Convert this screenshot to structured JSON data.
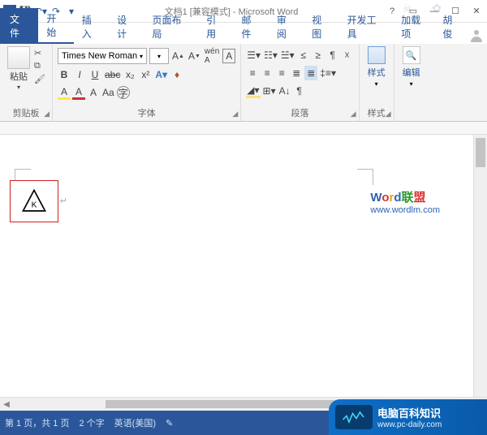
{
  "titlebar": {
    "doc_title": "文档1 [兼容模式] - Microsoft Word"
  },
  "tabs": {
    "file": "文件",
    "home": "开始",
    "insert": "插入",
    "design": "设计",
    "layout": "页面布局",
    "references": "引用",
    "mailings": "邮件",
    "review": "审阅",
    "view": "视图",
    "developer": "开发工具",
    "addins": "加载项",
    "user": "胡俊"
  },
  "ribbon": {
    "clipboard": {
      "label": "剪贴板",
      "paste": "粘贴"
    },
    "font": {
      "label": "字体",
      "name": "Times New Roman",
      "bold": "B",
      "italic": "I",
      "underline": "U",
      "strike": "abc",
      "sub": "x₂",
      "sup": "x²",
      "row3": {
        "a1": "A",
        "a2": "ab/",
        "a3": "A",
        "a4": "Aa",
        "change": "A"
      }
    },
    "paragraph": {
      "label": "段落"
    },
    "styles": {
      "label": "样式",
      "button": "样式"
    },
    "editing": {
      "label": "",
      "button": "编辑"
    }
  },
  "document": {
    "triangle_letter": "K"
  },
  "watermark": {
    "text": "Word联盟",
    "url": "www.wordlm.com"
  },
  "status": {
    "page": "第 1 页，共 1 页",
    "words": "2 个字",
    "lang": "英语(美国)"
  },
  "banner": {
    "title": "电脑百科知识",
    "url": "www.pc-daily.com"
  }
}
